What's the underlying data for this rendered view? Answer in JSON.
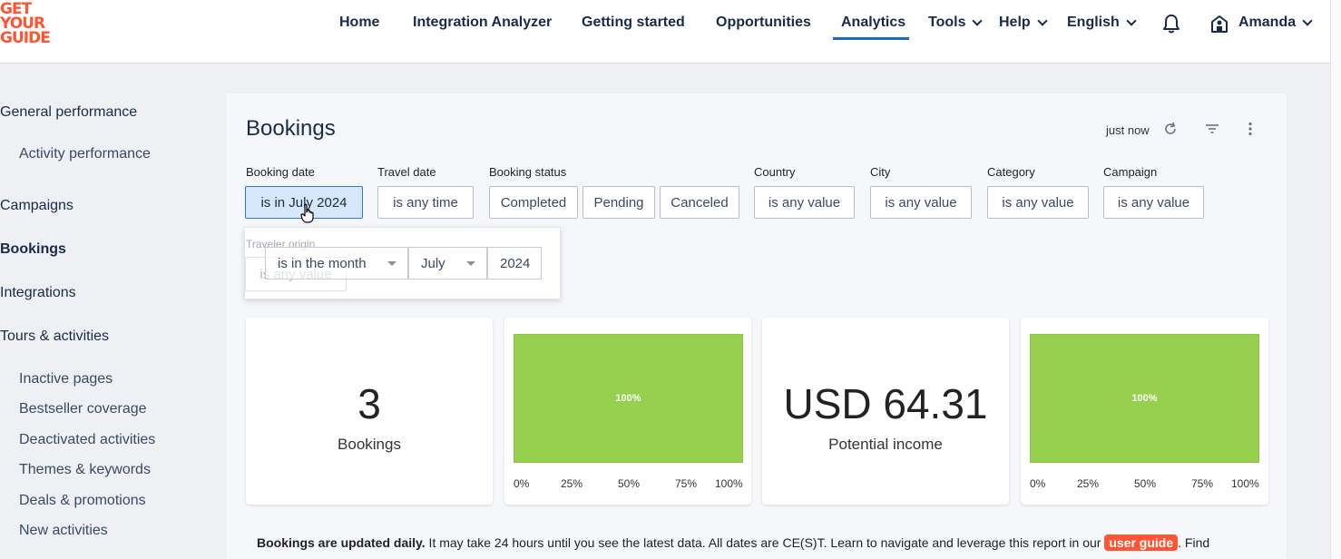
{
  "header": {
    "logo_lines": [
      "GET",
      "YOUR",
      "GUIDE"
    ],
    "nav": [
      {
        "label": "Home"
      },
      {
        "label": "Integration Analyzer"
      },
      {
        "label": "Getting started"
      },
      {
        "label": "Opportunities"
      },
      {
        "label": "Analytics",
        "active": true
      },
      {
        "label": "Tools"
      },
      {
        "label": "Help"
      },
      {
        "label": "English"
      }
    ],
    "user_name": "Amanda",
    "accent_color": "#1a6cc4",
    "brand_color": "#ff5533"
  },
  "sidebar": {
    "items": [
      {
        "label": "General performance"
      },
      {
        "label": "Activity performance"
      },
      {
        "label": "Campaigns"
      },
      {
        "label": "Bookings",
        "active": true
      },
      {
        "label": "Integrations"
      },
      {
        "label": "Tours & activities"
      },
      {
        "label": "Inactive pages"
      },
      {
        "label": "Bestseller coverage"
      },
      {
        "label": "Deactivated activities"
      },
      {
        "label": "Themes & keywords"
      },
      {
        "label": "Deals & promotions"
      },
      {
        "label": "New activities"
      }
    ]
  },
  "page": {
    "title": "Bookings",
    "refreshed": "just now"
  },
  "filters": {
    "booking_date": {
      "label": "Booking date",
      "value": "is in July 2024"
    },
    "travel_date": {
      "label": "Travel date",
      "value": "is any time"
    },
    "booking_status": {
      "label": "Booking status",
      "options": [
        "Completed",
        "Pending",
        "Canceled"
      ]
    },
    "country": {
      "label": "Country",
      "value": "is any value"
    },
    "city": {
      "label": "City",
      "value": "is any value"
    },
    "category": {
      "label": "Category",
      "value": "is any value"
    },
    "campaign": {
      "label": "Campaign",
      "value": "is any value"
    },
    "traveler_origin": {
      "label": "Traveler origin",
      "value": "is any value"
    }
  },
  "date_popup": {
    "operator": "is in the month",
    "month": "July",
    "year": "2024"
  },
  "cards": {
    "bookings": {
      "value": "3",
      "label": "Bookings"
    },
    "income": {
      "value": "USD 64.31",
      "label": "Potential income"
    },
    "bar1": {
      "label": "100%",
      "fraction": 1.0
    },
    "bar2": {
      "label": "100%",
      "fraction": 1.0
    },
    "ticks": [
      "0%",
      "25%",
      "50%",
      "75%",
      "100%"
    ],
    "bar_color": "#97cf4f"
  },
  "footer": {
    "bold": "Bookings are updated daily.",
    "text": " It may take 24 hours until you see the latest data. All dates are CE(S)T. Learn to navigate and leverage this report in our ",
    "link": "user guide",
    "tail": ". Find"
  }
}
